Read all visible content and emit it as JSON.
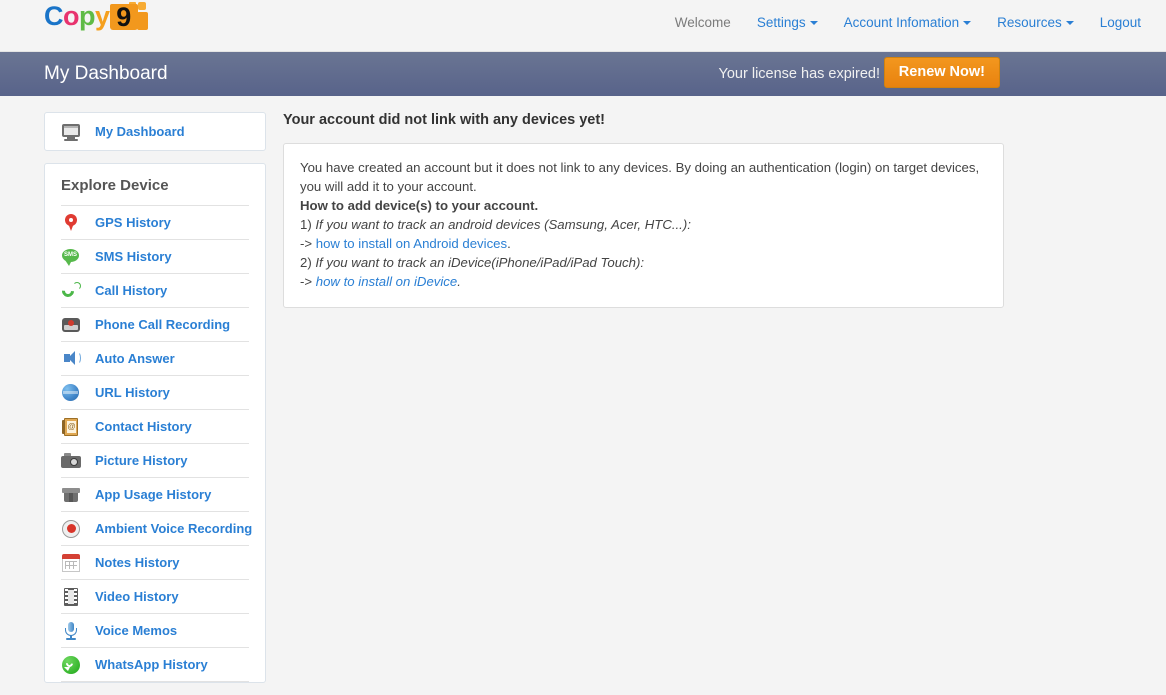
{
  "header": {
    "logo": {
      "text_c": "C",
      "text_o": "o",
      "text_p": "p",
      "text_y": "y",
      "mark_digit": "9"
    },
    "nav": [
      {
        "label": "Welcome",
        "has_caret": false
      },
      {
        "label": "Settings",
        "has_caret": true
      },
      {
        "label": "Account Infomation",
        "has_caret": true
      },
      {
        "label": "Resources",
        "has_caret": true
      },
      {
        "label": "Logout",
        "has_caret": false
      }
    ]
  },
  "banner": {
    "title": "My Dashboard",
    "license_message": "Your license has expired!",
    "renew_label": "Renew Now!",
    "bg_color": "#626d8c",
    "button_color": "#ef911b"
  },
  "sidebar": {
    "dashboard": {
      "label": "My Dashboard",
      "icon": "monitor-icon"
    },
    "explore_heading": "Explore Device",
    "items": [
      {
        "label": "GPS History",
        "icon": "map-pin-icon"
      },
      {
        "label": "SMS History",
        "icon": "sms-bubble-icon"
      },
      {
        "label": "Call History",
        "icon": "phone-handset-icon"
      },
      {
        "label": "Phone Call Recording",
        "icon": "voice-recorder-icon"
      },
      {
        "label": "Auto Answer",
        "icon": "speaker-icon"
      },
      {
        "label": "URL History",
        "icon": "globe-icon"
      },
      {
        "label": "Contact History",
        "icon": "address-book-icon"
      },
      {
        "label": "Picture History",
        "icon": "camera-icon"
      },
      {
        "label": "App Usage History",
        "icon": "package-box-icon"
      },
      {
        "label": "Ambient Voice Recording",
        "icon": "record-button-icon"
      },
      {
        "label": "Notes History",
        "icon": "calendar-icon"
      },
      {
        "label": "Video History",
        "icon": "film-strip-icon"
      },
      {
        "label": "Voice Memos",
        "icon": "microphone-icon"
      },
      {
        "label": "WhatsApp History",
        "icon": "whatsapp-icon"
      }
    ]
  },
  "main": {
    "heading": "Your account did not link with any devices yet!",
    "paragraph": "You have created an account but it does not link to any devices. By doing an authentication (login) on target devices, you will add it to your account.",
    "how_to_title": "How to add device(s) to your account.",
    "step1_prefix": "1) ",
    "step1_text": "If you want to track an android devices (Samsung, Acer, HTC...):",
    "step1_arrow": "-> ",
    "step1_link": "how to install on Android devices",
    "step1_end": ".",
    "step2_prefix": "2) ",
    "step2_text": "If you want to track an iDevice(iPhone/iPad/iPad Touch):",
    "step2_arrow": "-> ",
    "step2_link": "how to install on iDevice",
    "step2_end": "."
  }
}
